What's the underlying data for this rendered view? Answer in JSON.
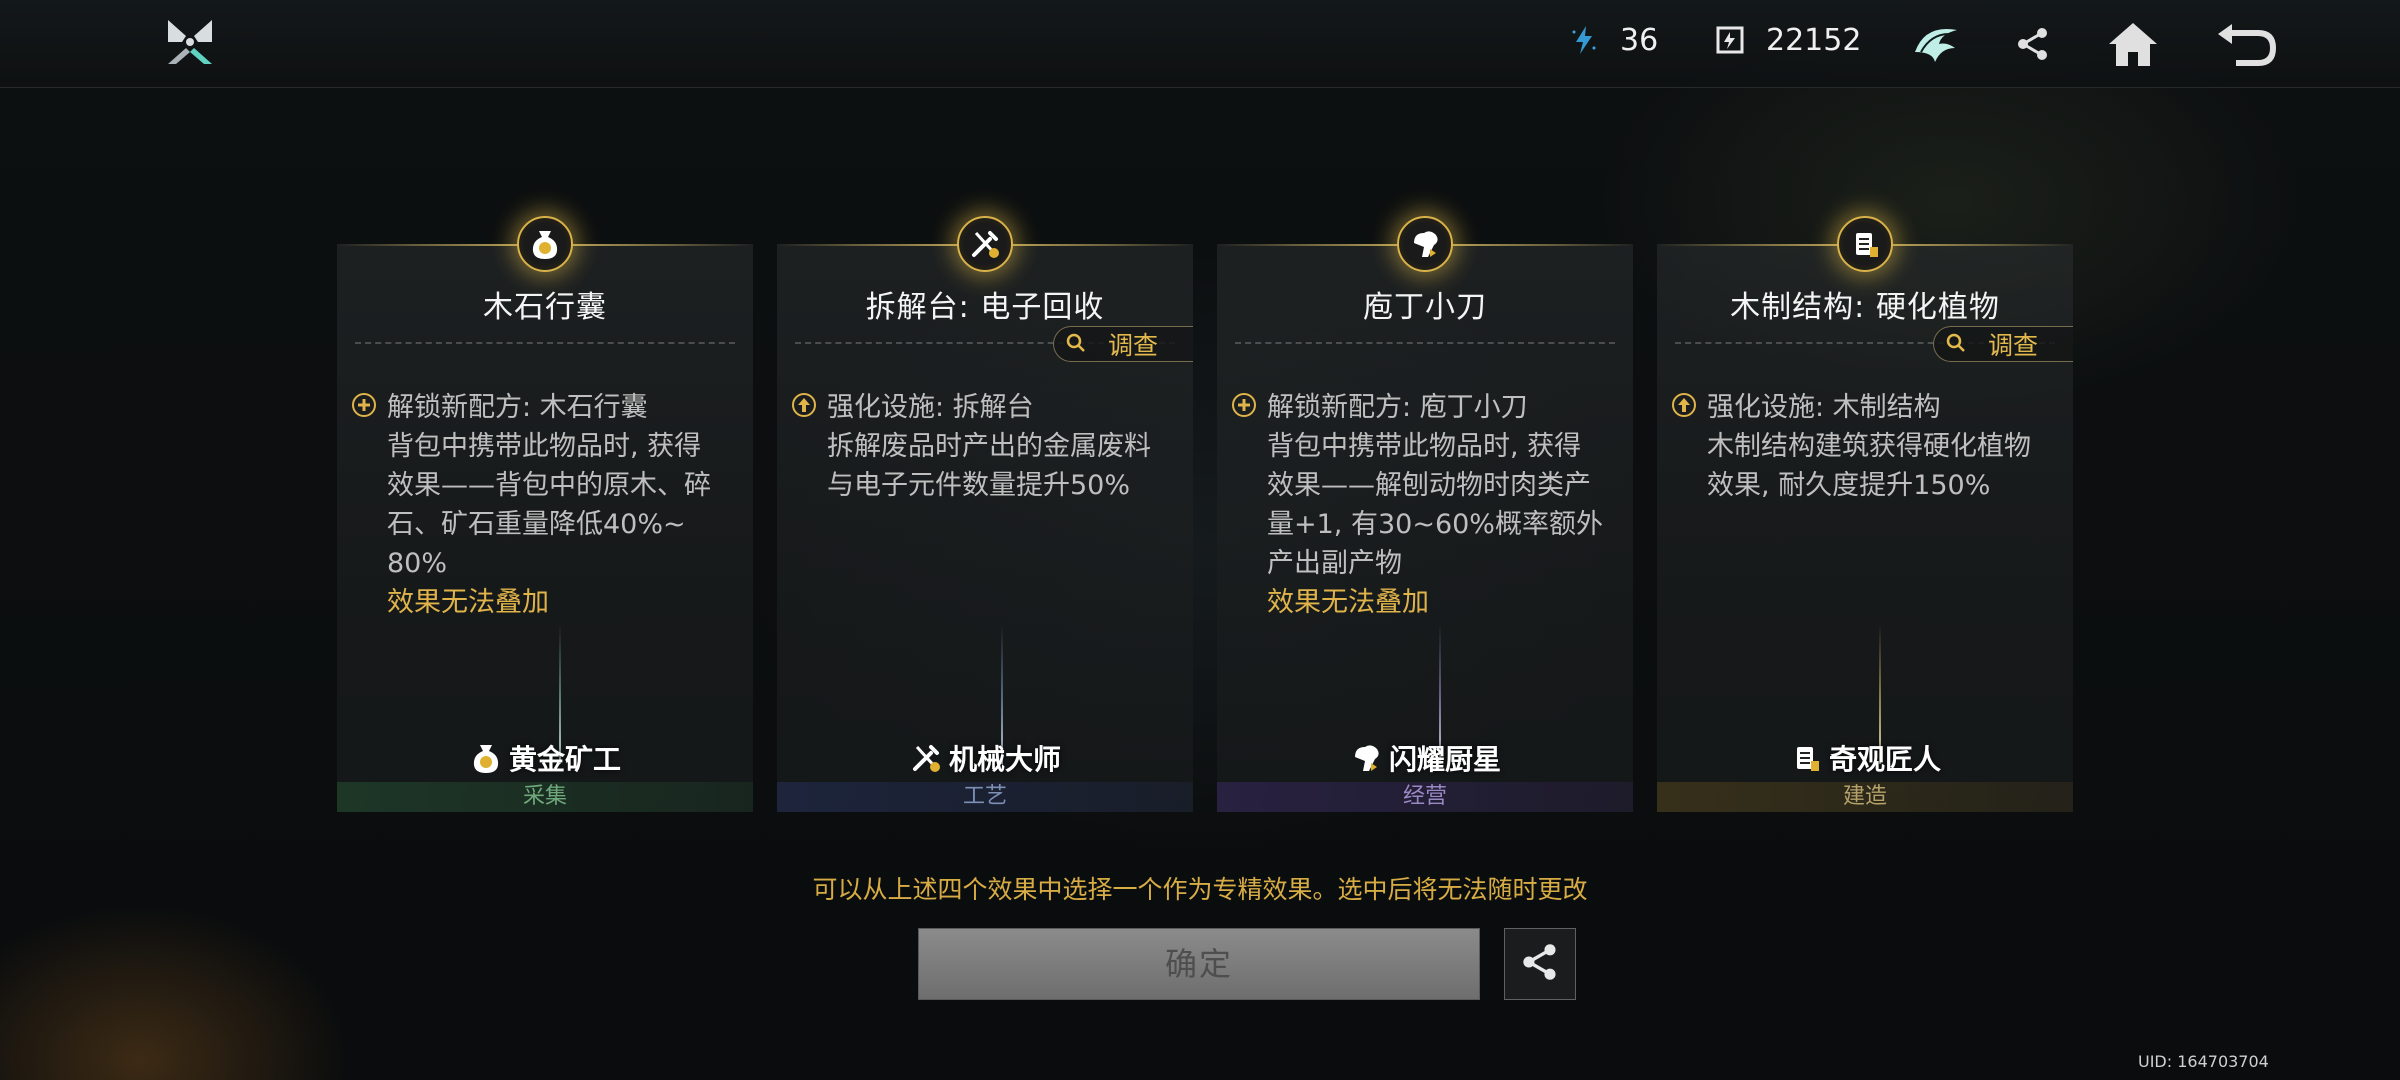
{
  "topbar": {
    "resource1": {
      "icon": "energy-icon",
      "value": "36"
    },
    "resource2": {
      "icon": "token-icon",
      "value": "22152"
    },
    "buttons": [
      "emblem-icon",
      "share-icon",
      "home-icon",
      "back-icon"
    ]
  },
  "cards": [
    {
      "icon": "moneybag-icon",
      "title": "木石行囊",
      "effect_icon": "plus-circle-icon",
      "lines": [
        "解锁新配方: 木石行囊",
        "背包中携带此物品时, 获得",
        "效果——背包中的原木、碎",
        "石、矿石重量降低40%~",
        "80%"
      ],
      "warning": "效果无法叠加",
      "master": "黄金矿工",
      "category": "采集",
      "category_color": "#6fa87a",
      "category_bg": "#1e3a28"
    },
    {
      "icon": "wrench-icon",
      "title": "拆解台: 电子回收",
      "investigate": "调查",
      "effect_icon": "upgrade-arrow-icon",
      "lines": [
        "强化设施: 拆解台",
        "拆解废品时产出的金属废料",
        "与电子元件数量提升50%"
      ],
      "master": "机械大师",
      "category": "工艺",
      "category_color": "#7d8fb5",
      "category_bg": "#1e2640"
    },
    {
      "icon": "chef-icon",
      "title": "庖丁小刀",
      "effect_icon": "plus-circle-icon",
      "lines": [
        "解锁新配方: 庖丁小刀",
        "背包中携带此物品时, 获得",
        "效果——解刨动物时肉类产",
        "量+1, 有30~60%概率额外",
        "产出副产物"
      ],
      "warning": "效果无法叠加",
      "master": "闪耀厨星",
      "category": "经营",
      "category_color": "#9988c2",
      "category_bg": "#2a2245"
    },
    {
      "icon": "building-icon",
      "title": "木制结构: 硬化植物",
      "investigate": "调查",
      "effect_icon": "upgrade-arrow-icon",
      "lines": [
        "强化设施: 木制结构",
        "木制结构建筑获得硬化植物",
        "效果, 耐久度提升150%"
      ],
      "master": "奇观匠人",
      "category": "建造",
      "category_color": "#b5a26a",
      "category_bg": "#3a321a"
    }
  ],
  "hint": "可以从上述四个效果中选择一个作为专精效果。选中后将无法随时更改",
  "confirm_label": "确定",
  "uid": "UID: 164703704"
}
